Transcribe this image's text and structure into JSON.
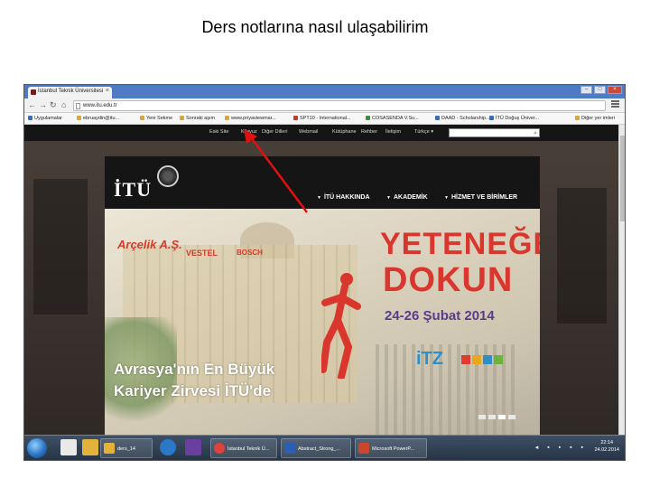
{
  "slide": {
    "title": "Ders notlarına nasıl ulaşabilirim"
  },
  "browser": {
    "tab_title": "İstanbul Teknik Üniversitesi",
    "url": "www.itu.edu.tr",
    "bookmarks": [
      "Uygulamalar",
      "ebruaydin@itu...",
      "Yeni Sekme",
      "Sonraki aşım",
      "www.priyaviewmar...",
      "SPT10 - International...",
      "COSASENDA V.Su...",
      "DAAD - Scholarship...",
      "İTÜ Doğuş Üniver...",
      "Diğer yer imleri"
    ]
  },
  "site": {
    "topnav": [
      "Eski Site",
      "Kilavuz",
      "Diğer Dilleri",
      "Webmail",
      "Kütüphane",
      "Rehber",
      "İletişim"
    ],
    "language": "Türkçe",
    "logo_text": "İTÜ",
    "mainnav": [
      "İTÜ HAKKINDA",
      "AKADEMİK",
      "HİZMET VE BİRİMLER"
    ],
    "banner": {
      "sponsor1": "Arçelik A.Ş.",
      "sponsor2": "VESTEL",
      "sponsor3": "BOSCH",
      "headline1": "YETENEĞE",
      "headline2": "DOKUN",
      "date": "24-26 Şubat 2014",
      "itz": "iTZ",
      "tagline1": "Avrasya'nın En Büyük",
      "tagline2": "Kariyer Zirvesi İTÜ'de"
    }
  },
  "taskbar": {
    "items": [
      "ders_14",
      "İstanbul Teknik Ü...",
      "Abstract_Strong_...",
      "Microsoft PowerP..."
    ],
    "time": "22:14",
    "date": "24.02.2014"
  },
  "colors": {
    "brand_red": "#d9372d",
    "annotation_red": "#e01010"
  }
}
